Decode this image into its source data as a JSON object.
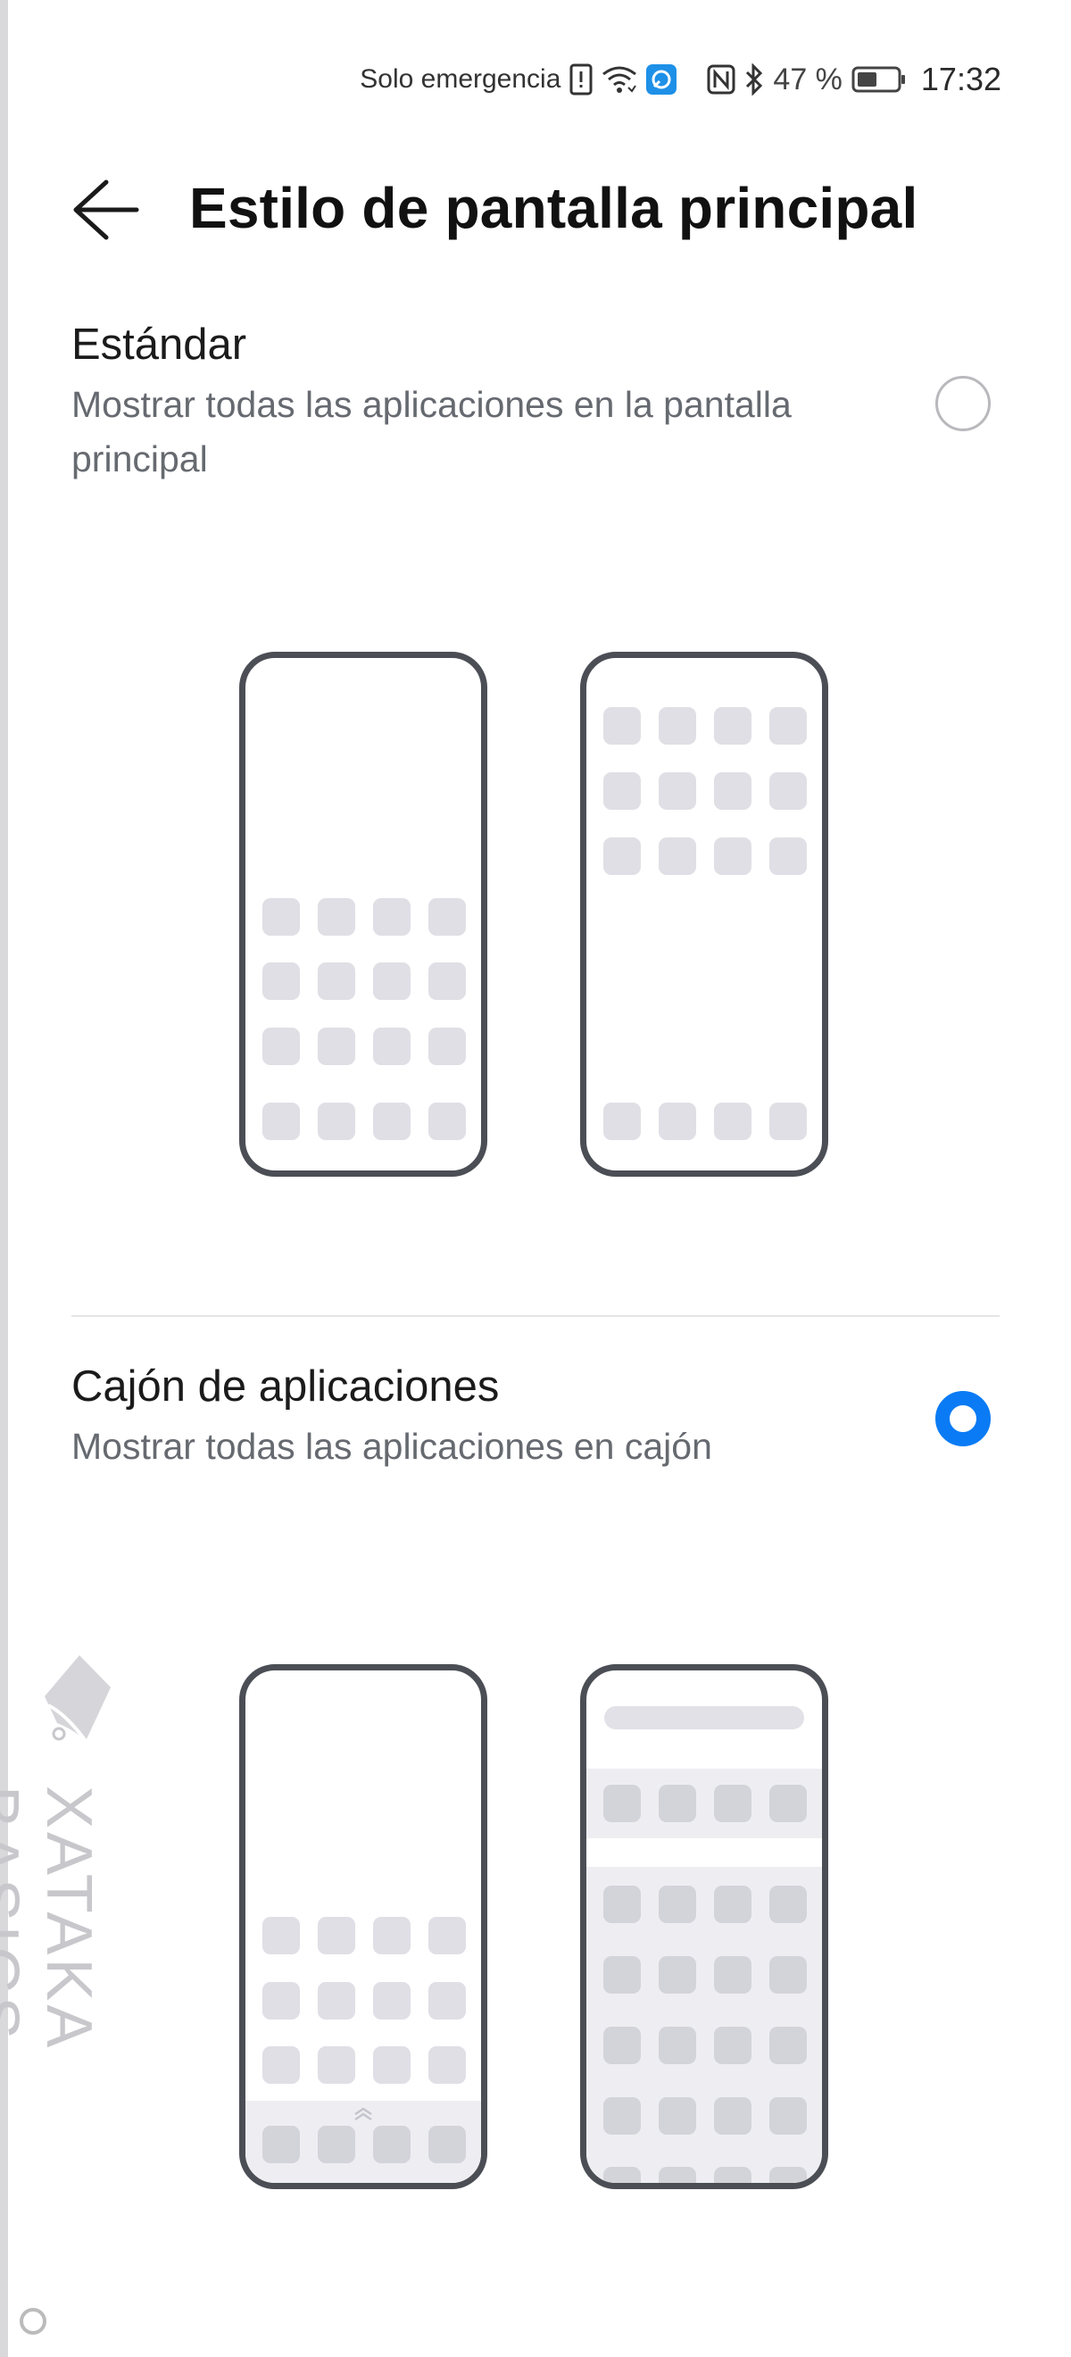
{
  "status_bar": {
    "carrier": "Solo emergencia",
    "battery": "47 %",
    "time": "17:32"
  },
  "header": {
    "title": "Estilo de pantalla principal"
  },
  "options": [
    {
      "title": "Estándar",
      "description": "Mostrar todas las aplicaciones en la pantalla principal",
      "selected": false
    },
    {
      "title": "Cajón de aplicaciones",
      "description": "Mostrar todas las aplicaciones en cajón",
      "selected": true
    }
  ],
  "colors": {
    "accent": "#0a7bf4",
    "phone_outline": "#4b4e55",
    "app_tile": "#dfdfe5"
  },
  "watermark": {
    "text": "XATAKA BASICS"
  }
}
